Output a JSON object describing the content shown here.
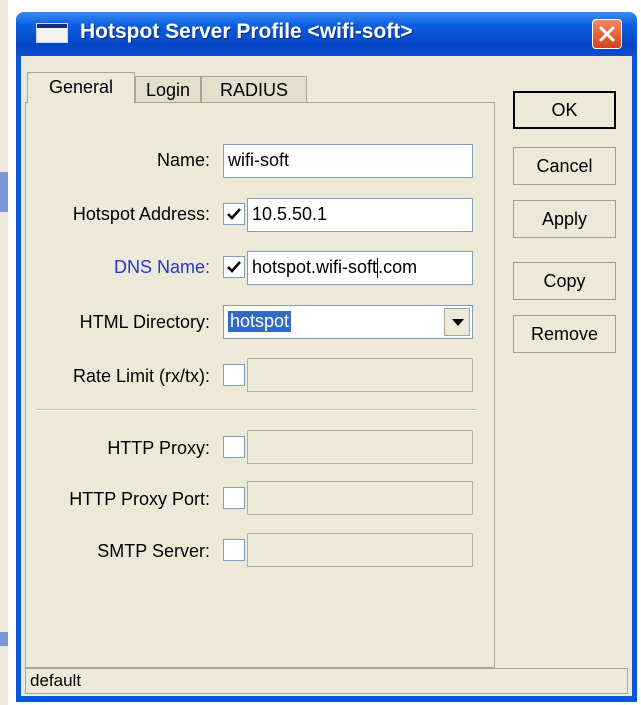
{
  "window": {
    "title": "Hotspot Server Profile <wifi-soft>"
  },
  "tabs": [
    {
      "label": "General",
      "active": true
    },
    {
      "label": "Login",
      "active": false
    },
    {
      "label": "RADIUS",
      "active": false
    }
  ],
  "form": {
    "name": {
      "label": "Name:",
      "value": "wifi-soft"
    },
    "hotspot_address": {
      "label": "Hotspot Address:",
      "checked": true,
      "value": "10.5.50.1"
    },
    "dns_name": {
      "label": "DNS Name:",
      "checked": true,
      "value_before_caret": "hotspot.wifi-soft",
      "value_after_caret": ".com"
    },
    "html_directory": {
      "label": "HTML Directory:",
      "value": "hotspot"
    },
    "rate_limit": {
      "label": "Rate Limit (rx/tx):",
      "checked": false,
      "value": ""
    },
    "http_proxy": {
      "label": "HTTP Proxy:",
      "checked": false,
      "value": ""
    },
    "http_proxy_port": {
      "label": "HTTP Proxy Port:",
      "checked": false,
      "value": ""
    },
    "smtp_server": {
      "label": "SMTP Server:",
      "checked": false,
      "value": ""
    }
  },
  "buttons": {
    "ok": "OK",
    "cancel": "Cancel",
    "apply": "Apply",
    "copy": "Copy",
    "remove": "Remove"
  },
  "status": "default",
  "colors": {
    "titlebar": "#0a57d4",
    "dialog_bg": "#ece9d8",
    "dns_label": "#2a35c8",
    "selection": "#316ac5",
    "close_button": "#d6401c"
  }
}
